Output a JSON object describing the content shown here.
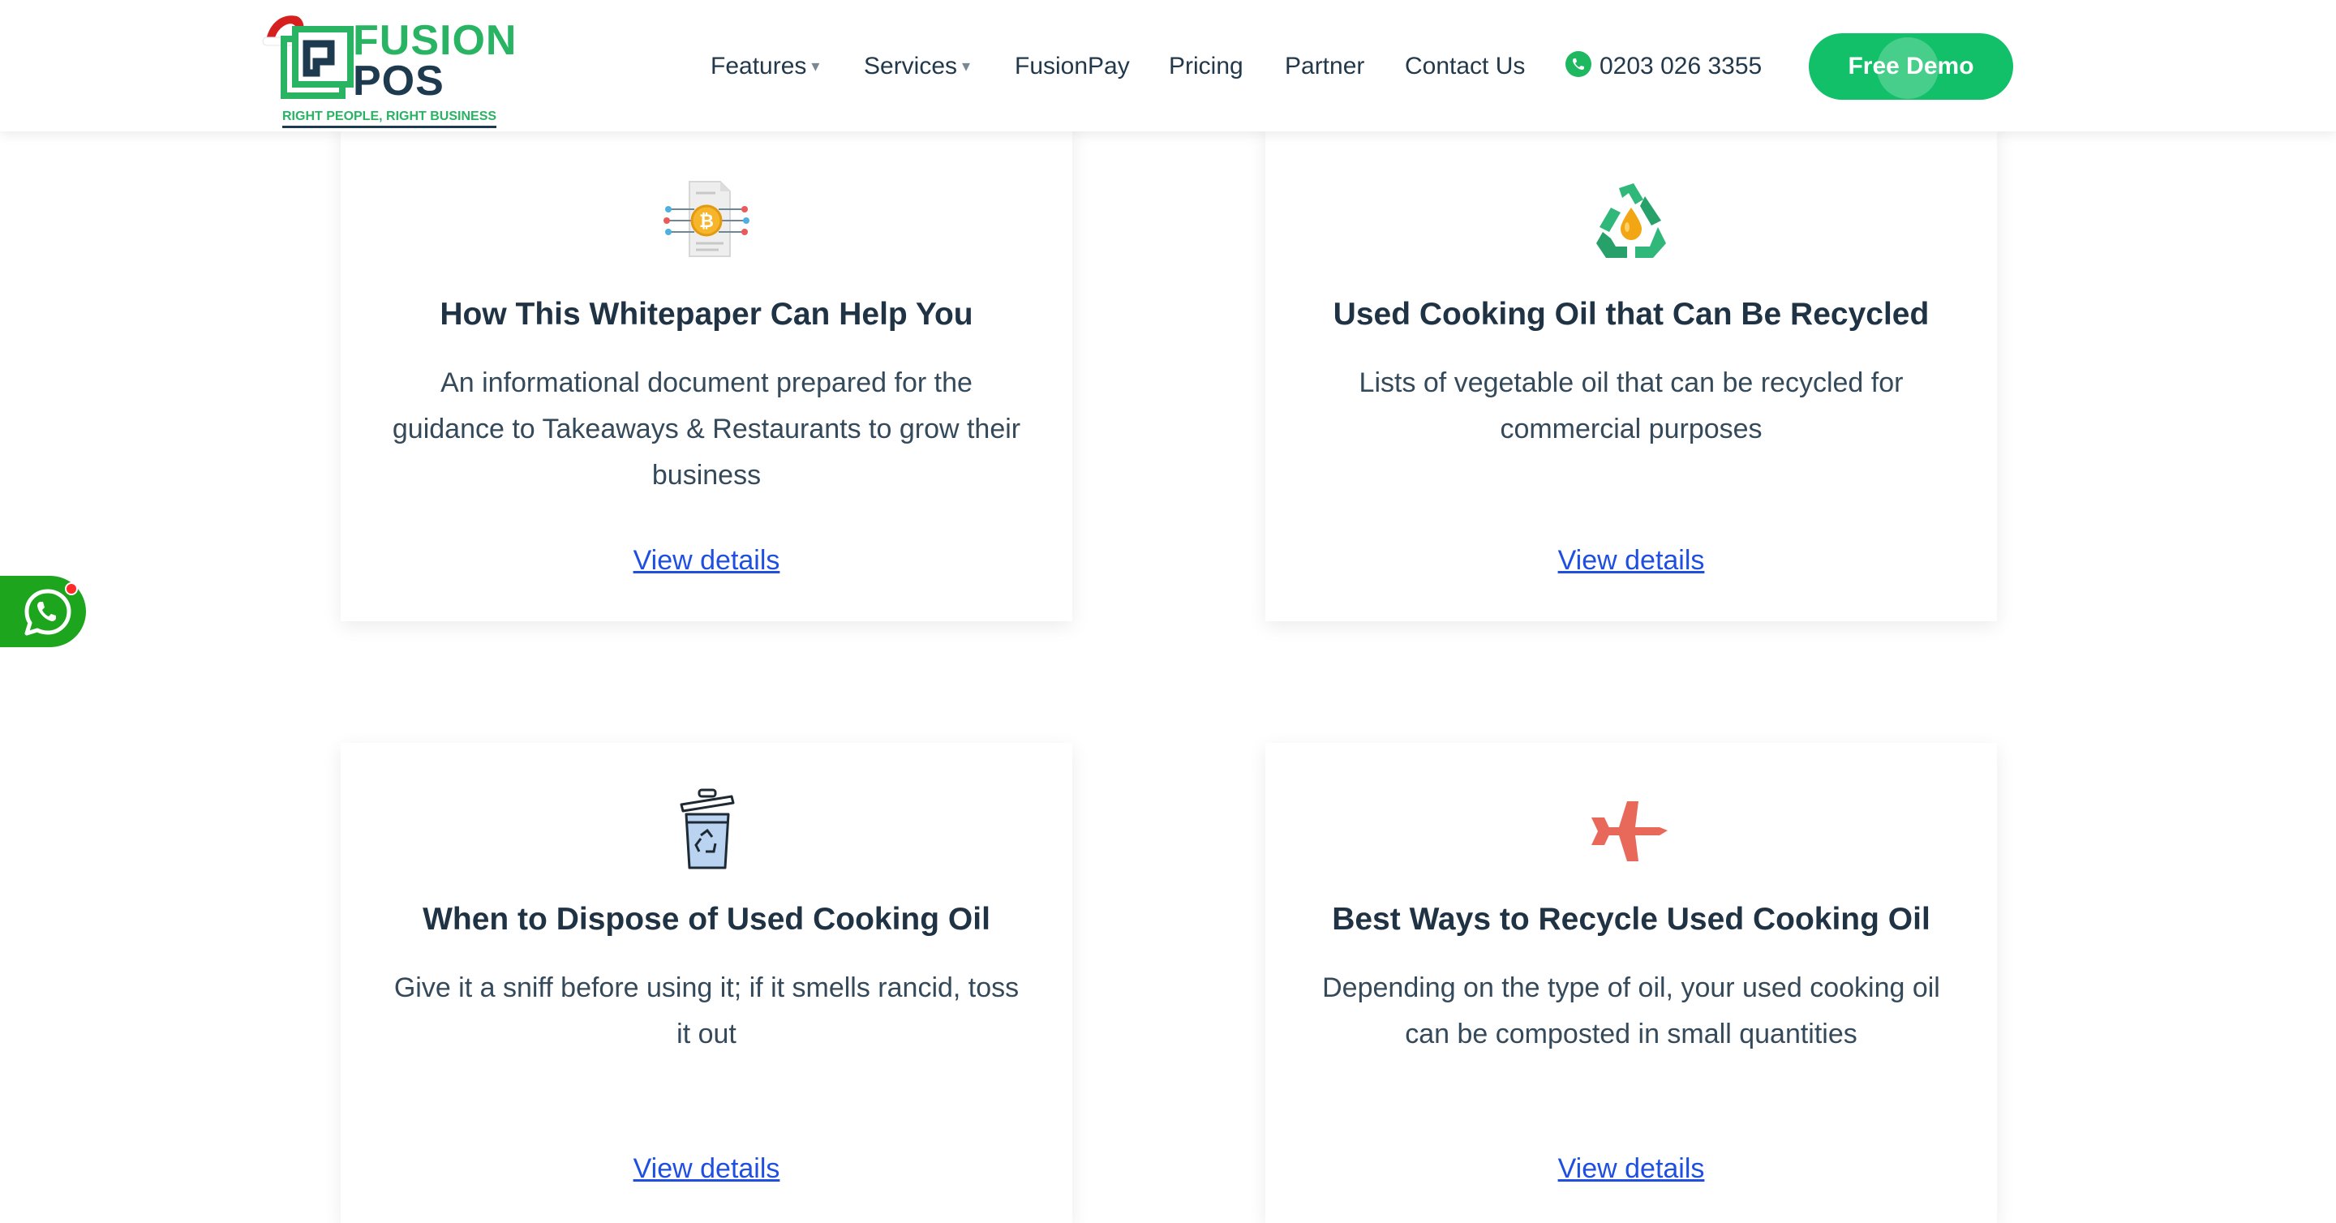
{
  "header": {
    "logo": {
      "word1": "FUSION",
      "word2": "POS",
      "tagline": "RIGHT PEOPLE, RIGHT BUSINESS"
    },
    "nav": [
      {
        "label": "Features",
        "caret": "▾"
      },
      {
        "label": "Services",
        "caret": "▾"
      },
      {
        "label": "FusionPay"
      },
      {
        "label": "Pricing"
      },
      {
        "label": "Partner"
      },
      {
        "label": "Contact Us"
      }
    ],
    "phone": "0203 026 3355",
    "cta": "Free Demo"
  },
  "cards": [
    {
      "icon": "bitcoin-document-icon",
      "title": "How This Whitepaper Can Help You",
      "desc": "An informational document prepared for the guidance to Takeaways & Restaurants to grow their business",
      "link": "View details"
    },
    {
      "icon": "recycle-oil-icon",
      "title": "Used Cooking Oil that Can Be Recycled",
      "desc": "Lists of vegetable oil that can be recycled for commercial purposes",
      "link": "View details"
    },
    {
      "icon": "recycle-bin-icon",
      "title": "When to Dispose of Used Cooking Oil",
      "desc": "Give it a sniff before using it; if it smells rancid, toss it out",
      "link": "View details"
    },
    {
      "icon": "airplane-icon",
      "title": "Best Ways to Recycle Used Cooking Oil",
      "desc": "Depending on the type of oil, your used cooking oil can be composted in small quantities",
      "link": "View details"
    }
  ],
  "colors": {
    "brand_green": "#28b463",
    "cta_green": "#12c06a",
    "navy": "#1d3a4f",
    "link_blue": "#1f4fe0",
    "whatsapp_green": "#1ea51e",
    "airplane_red": "#e8685a"
  },
  "whatsapp": {
    "icon": "whatsapp-icon"
  }
}
